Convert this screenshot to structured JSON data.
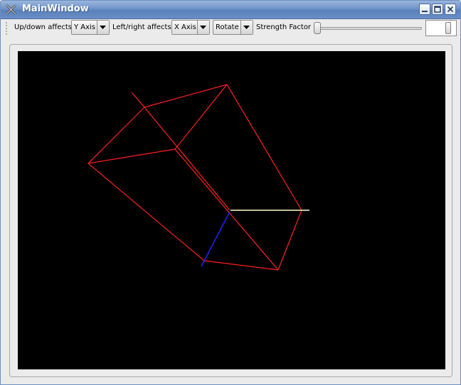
{
  "window": {
    "title": "MainWindow"
  },
  "toolbar": {
    "updown_label": "Up/down affects",
    "updown_value": "Y Axis",
    "leftright_label": "Left/right affects",
    "leftright_value": "X Axis",
    "mode_value": "Rotate",
    "strength_label": "Strength Factor",
    "strength_level": 0
  },
  "scene": {
    "background_color": "#000000",
    "cube_color": "#ff2020",
    "x_axis_color": "#ffffcc",
    "z_axis_color": "#2020ff"
  }
}
